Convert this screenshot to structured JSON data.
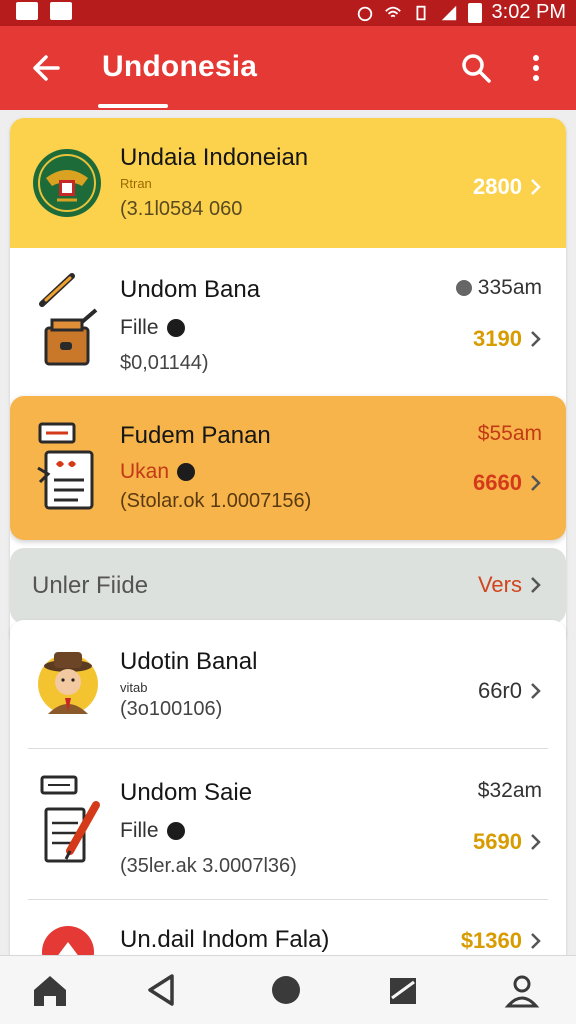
{
  "status": {
    "time": "3:02 PM"
  },
  "appbar": {
    "title": "Undonesia"
  },
  "items": [
    {
      "title": "Undaia Indoneian",
      "small": "Rtran",
      "detail": "(3.1l0584 060",
      "amount": "2800",
      "amount_color": "#ffffff",
      "icon": "emblem-icon"
    },
    {
      "title": "Undom Bana",
      "sub": "Fille",
      "detail": "$0,01144)",
      "time": "335am",
      "amount": "3190",
      "amount_color": "#d89b00",
      "icon": "toolbox-icon"
    },
    {
      "title": "Fudem Panan",
      "sub": "Ukan",
      "detail": "(Stolar.ok 1.0007156)",
      "time": "$55am",
      "amount": "6660",
      "amount_color": "#d43a1a",
      "icon": "checklist-icon"
    },
    {
      "title": "Udotin Banal",
      "small": "vitab",
      "detail": "(3o100106)",
      "amount": "66r0",
      "amount_color": "#333333",
      "icon": "person-avatar-icon"
    },
    {
      "title": "Undom Saie",
      "sub": "Fille",
      "detail": "(35ler.ak 3.0007l36)",
      "time": "$32am",
      "amount": "5690",
      "amount_color": "#d89b00",
      "icon": "notepad-pen-icon"
    },
    {
      "title": "Un.dail Indom Fala)",
      "amount": "$1360",
      "amount_color": "#d89b00",
      "icon": "alert-icon"
    }
  ],
  "section": {
    "title": "Unler Fiide",
    "link": "Vers"
  },
  "colors": {
    "appbar": "#e53935",
    "statusbar": "#b71c1c",
    "yellow": "#fcd24d",
    "orange": "#f7b44a"
  }
}
